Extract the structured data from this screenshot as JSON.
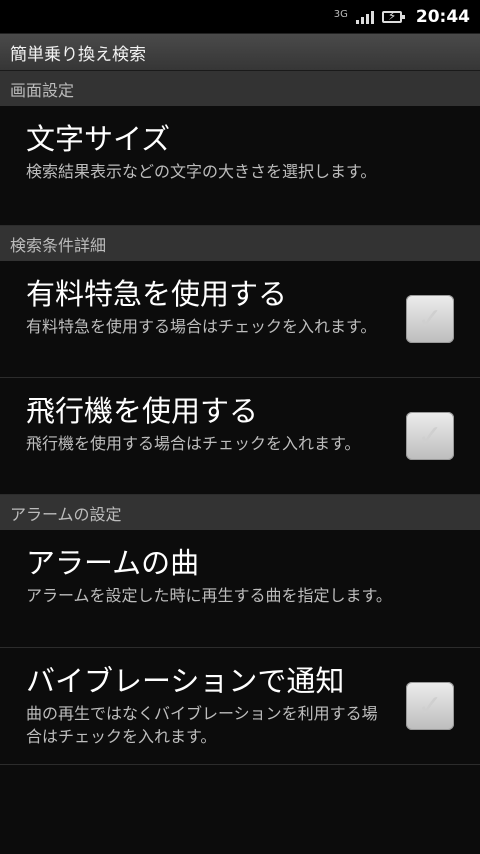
{
  "status_bar": {
    "network": "3G",
    "time": "20:44",
    "signal_icon": "signal-bars-icon",
    "battery_icon": "battery-charging-icon"
  },
  "app": {
    "title": "簡単乗り換え検索"
  },
  "sections": [
    {
      "header": "画面設定",
      "items": [
        {
          "title": "文字サイズ",
          "summary": "検索結果表示などの文字の大きさを選択します。"
        }
      ]
    },
    {
      "header": "検索条件詳細",
      "items": [
        {
          "title": "有料特急を使用する",
          "summary": "有料特急を使用する場合はチェックを入れます。",
          "checked": false
        },
        {
          "title": "飛行機を使用する",
          "summary": "飛行機を使用する場合はチェックを入れます。",
          "checked": false
        }
      ]
    },
    {
      "header": "アラームの設定",
      "items": [
        {
          "title": "アラームの曲",
          "summary": "アラームを設定した時に再生する曲を指定します。"
        },
        {
          "title": "バイブレーションで通知",
          "summary": "曲の再生ではなくバイブレーションを利用する場合はチェックを入れます。",
          "checked": false
        }
      ]
    }
  ]
}
